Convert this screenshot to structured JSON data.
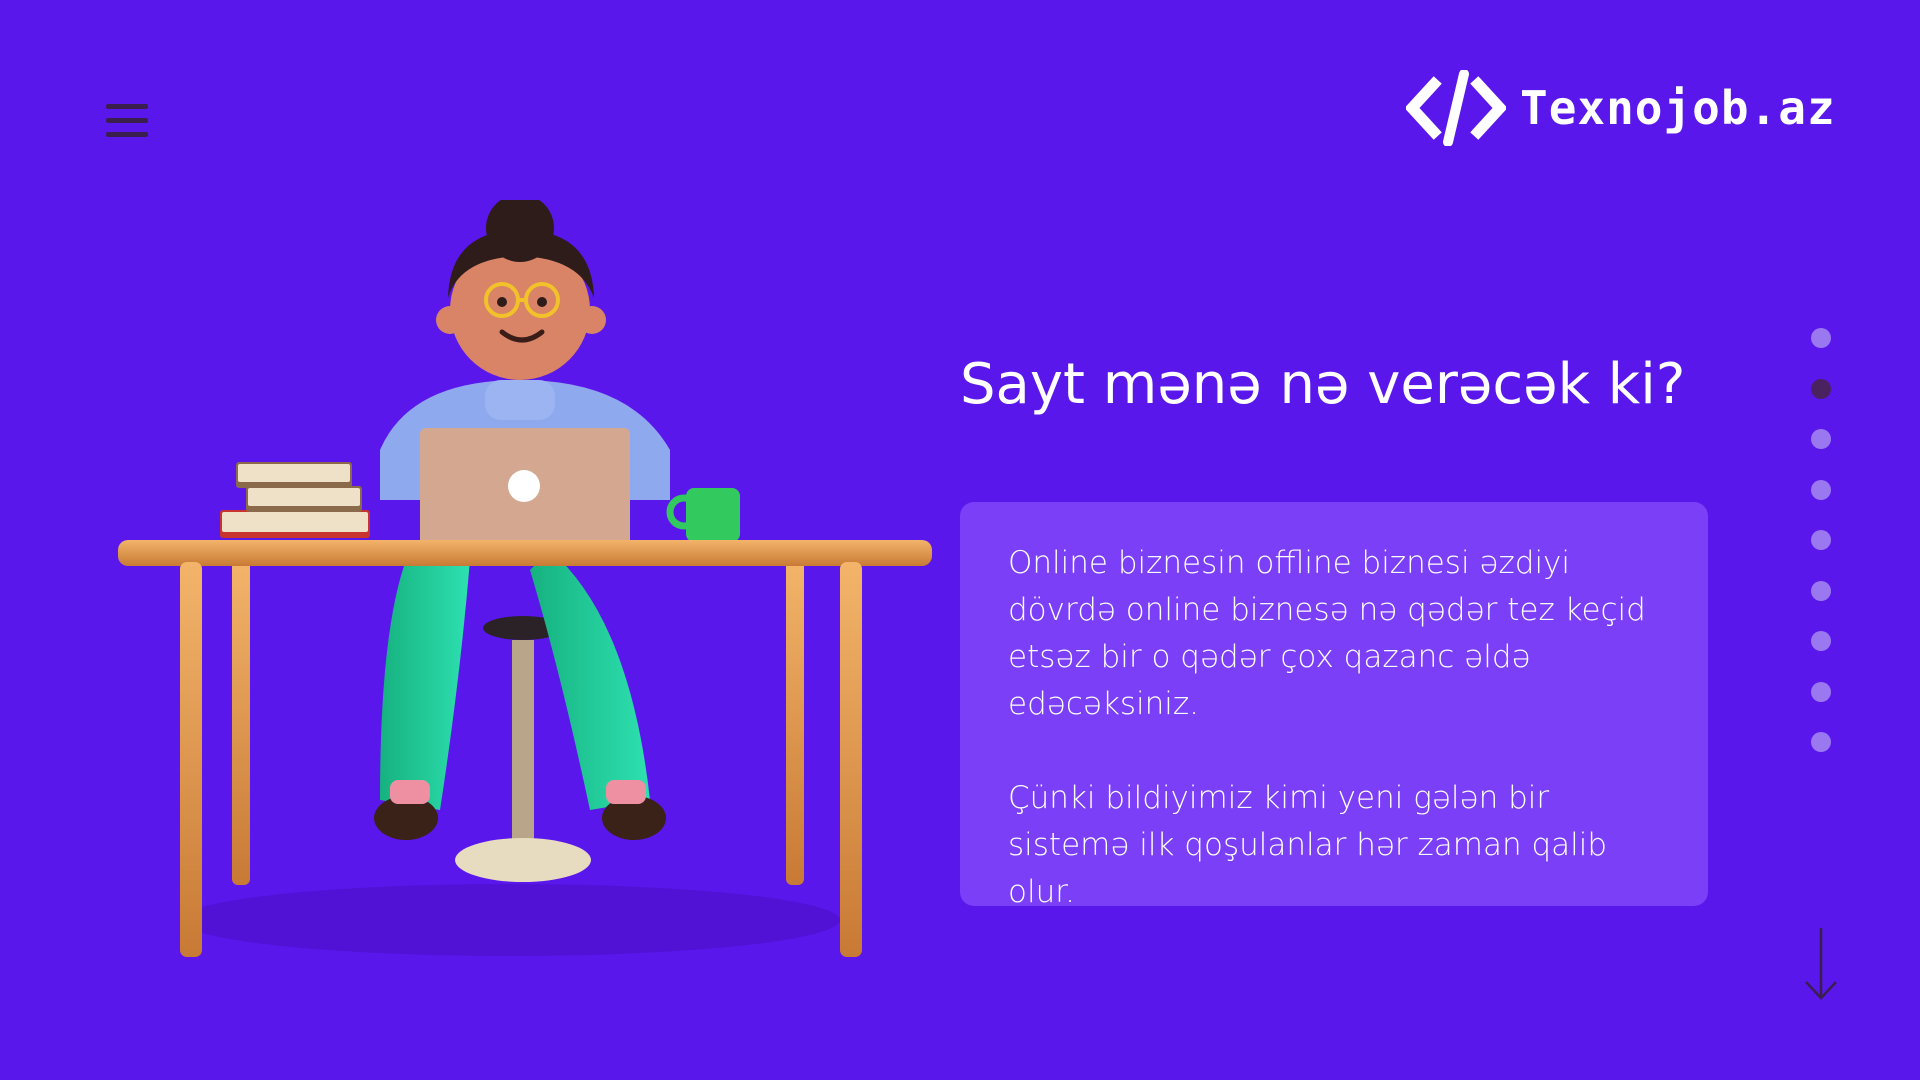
{
  "header": {
    "menu_icon": "hamburger-icon",
    "logo_icon": "code-brackets-icon",
    "logo_text": "Texnojob.az"
  },
  "hero": {
    "title": "Sayt mənə nə verəcək ki?",
    "paragraphs": [
      "Online biznesin offline biznesi əzdiyi dövrdə online biznesə nə qədər tez keçid etsəz  bir o qədər çox qazanc əldə edəcəksiniz.",
      "Çünki bildiyimiz kimi yeni gələn bir sistemə ilk qoşulanlar hər zaman qalib olur."
    ]
  },
  "pagination": {
    "total": 9,
    "active_index": 1
  },
  "scroll": {
    "icon": "arrow-down-icon"
  },
  "colors": {
    "background": "#5a17ec",
    "card": "#7b3ff7",
    "dot": "#9a78f0",
    "dot_active": "#4a2260",
    "menu": "#3a1f4e"
  }
}
